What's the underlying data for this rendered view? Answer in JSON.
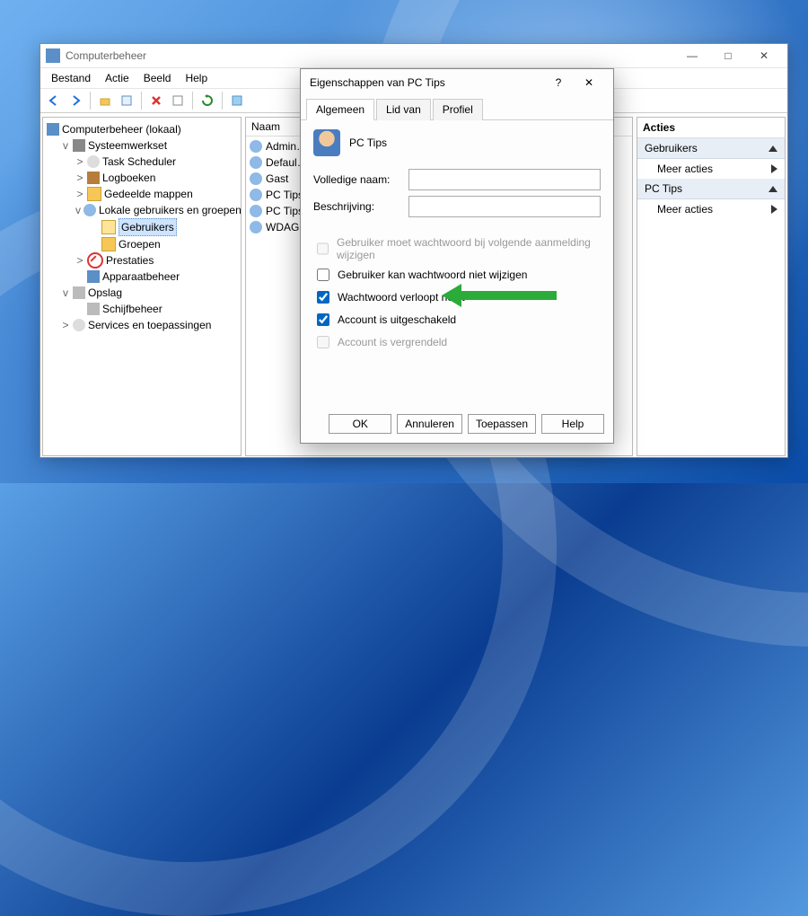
{
  "window": {
    "title": "Computerbeheer",
    "menu": [
      "Bestand",
      "Actie",
      "Beeld",
      "Help"
    ]
  },
  "tree": {
    "root": "Computerbeheer (lokaal)",
    "systools": "Systeemwerkset",
    "items": {
      "task": "Task Scheduler",
      "log": "Logboeken",
      "shared": "Gedeelde mappen",
      "lug": "Lokale gebruikers en groepen",
      "usersNode": "Gebruikers",
      "groupsNode": "Groepen",
      "perf": "Prestaties",
      "dev": "Apparaatbeheer"
    },
    "storage": "Opslag",
    "diskmgmt": "Schijfbeheer",
    "services": "Services en toepassingen"
  },
  "list": {
    "header": "Naam",
    "rows": [
      "Admin…",
      "Defaul…",
      "Gast",
      "PC Tips",
      "PC Tips",
      "WDAG…"
    ]
  },
  "actions": {
    "header": "Acties",
    "section1": "Gebruikers",
    "more1": "Meer acties",
    "section2": "PC Tips",
    "more2": "Meer acties"
  },
  "dialog": {
    "title": "Eigenschappen van PC Tips",
    "help": "?",
    "tabs": {
      "general": "Algemeen",
      "member": "Lid van",
      "profile": "Profiel"
    },
    "username": "PC Tips",
    "fullname_label": "Volledige naam:",
    "fullname_value": "",
    "description_label": "Beschrijving:",
    "description_value": "",
    "checks": {
      "mustchange": {
        "label": "Gebruiker moet wachtwoord bij volgende aanmelding wijzigen",
        "checked": false,
        "enabled": false
      },
      "cannotchange": {
        "label": "Gebruiker kan wachtwoord niet wijzigen",
        "checked": false,
        "enabled": true
      },
      "neverexp": {
        "label": "Wachtwoord verloopt nooit",
        "checked": true,
        "enabled": true
      },
      "disabled": {
        "label": "Account is uitgeschakeld",
        "checked": true,
        "enabled": true
      },
      "locked": {
        "label": "Account is vergrendeld",
        "checked": false,
        "enabled": false
      }
    },
    "buttons": {
      "ok": "OK",
      "cancel": "Annuleren",
      "apply": "Toepassen",
      "help": "Help"
    }
  }
}
